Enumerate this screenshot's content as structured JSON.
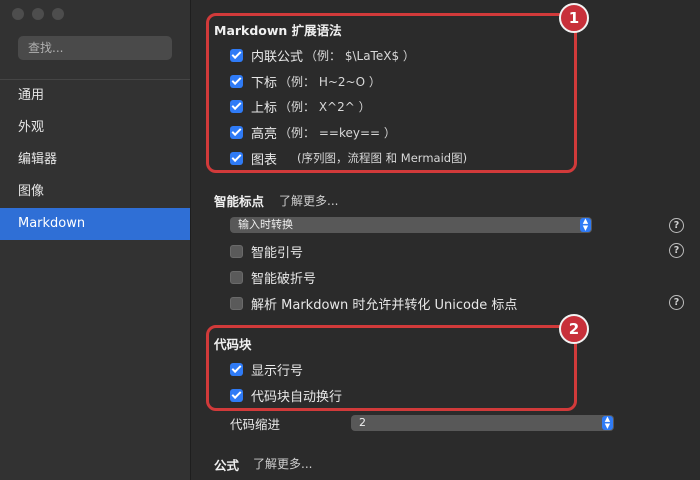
{
  "sidebar": {
    "search_placeholder": "查找...",
    "items": [
      {
        "label": "通用"
      },
      {
        "label": "外观"
      },
      {
        "label": "编辑器"
      },
      {
        "label": "图像"
      },
      {
        "label": "Markdown",
        "selected": true
      }
    ]
  },
  "markdown_ext": {
    "title": "Markdown 扩展语法",
    "options": [
      {
        "label": "内联公式",
        "hint": "（例： $\\LaTeX$ ）",
        "checked": true
      },
      {
        "label": "下标",
        "hint": "（例： H~2~O ）",
        "checked": true
      },
      {
        "label": "上标",
        "hint": "（例： X^2^ ）",
        "checked": true
      },
      {
        "label": "高亮",
        "hint": "（例： ==key== ）",
        "checked": true
      },
      {
        "label": "图表",
        "hint": "(序列图，流程图 和 Mermaid图)",
        "checked": true
      }
    ]
  },
  "smart_punct": {
    "title": "智能标点",
    "learn_more": "了解更多...",
    "mode_value": "输入时转换",
    "options": [
      {
        "label": "智能引号",
        "checked": false
      },
      {
        "label": "智能破折号",
        "checked": false
      },
      {
        "label": "解析 Markdown 时允许并转化 Unicode 标点",
        "checked": false
      }
    ]
  },
  "code_block": {
    "title": "代码块",
    "options": [
      {
        "label": "显示行号",
        "checked": true
      },
      {
        "label": "代码块自动换行",
        "checked": true
      }
    ],
    "indent_label": "代码缩进",
    "indent_value": "2"
  },
  "math": {
    "title": "公式",
    "learn_more": "了解更多..."
  },
  "annotations": {
    "badge_1": "1",
    "badge_2": "2",
    "highlight_color": "#d13a3a"
  },
  "colors": {
    "accent": "#2f7bf6",
    "sidebar_selected": "#2f6fd6"
  },
  "help_icon": "?"
}
